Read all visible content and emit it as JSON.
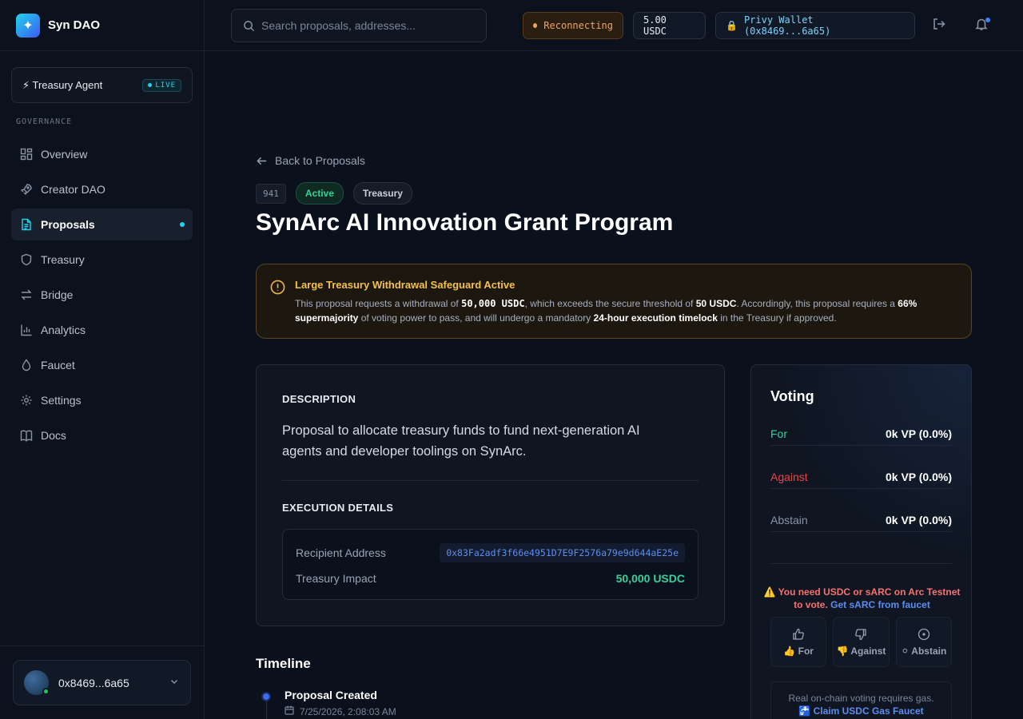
{
  "brand": {
    "name": "Syn DAO",
    "logo_icon": "sparkle-icon"
  },
  "agent": {
    "label": "⚡ Treasury Agent",
    "badge": "LIVE"
  },
  "sidebar": {
    "section": "GOVERNANCE",
    "items": [
      {
        "label": "Overview",
        "icon": "grid-icon"
      },
      {
        "label": "Creator DAO",
        "icon": "rocket-icon"
      },
      {
        "label": "Proposals",
        "icon": "document-icon",
        "active": true
      },
      {
        "label": "Treasury",
        "icon": "shield-icon"
      },
      {
        "label": "Bridge",
        "icon": "swap-arrows-icon"
      },
      {
        "label": "Analytics",
        "icon": "bar-chart-icon"
      },
      {
        "label": "Faucet",
        "icon": "droplet-icon"
      },
      {
        "label": "Settings",
        "icon": "gear-icon"
      },
      {
        "label": "Docs",
        "icon": "book-icon"
      }
    ],
    "user": {
      "address": "0x8469...6a65"
    }
  },
  "topbar": {
    "search": {
      "placeholder": "Search proposals, addresses...",
      "value": ""
    },
    "status": "Reconnecting",
    "balance": "5.00 USDC",
    "wallet": "Privy Wallet (0x8469...6a65)"
  },
  "proposal": {
    "back_label": "Back to Proposals",
    "id": "941",
    "status": "Active",
    "type": "Treasury",
    "title": "SynArc AI Innovation Grant Program",
    "alert": {
      "title": "Large Treasury Withdrawal Safeguard Active",
      "p1": "This proposal requests a withdrawal of ",
      "amount": "50,000 USDC",
      "p2": ", which exceeds the secure threshold of ",
      "threshold": "50 USDC",
      "p3": ". Accordingly, this proposal requires a ",
      "majority": "66% supermajority",
      "p4": " of voting power to pass, and will undergo a mandatory ",
      "timelock": "24-hour execution timelock",
      "p5": " in the Treasury if approved."
    },
    "description_label": "DESCRIPTION",
    "description": "Proposal to allocate treasury funds to fund next-generation AI agents and developer toolings on SynArc.",
    "execution_label": "EXECUTION DETAILS",
    "recipient_label": "Recipient Address",
    "recipient": "0x83Fa2adf3f66e4951D7E9F2576a79e9d644aE25e",
    "impact_label": "Treasury Impact",
    "impact": "50,000 USDC",
    "timeline_label": "Timeline",
    "timeline": [
      {
        "event": "Proposal Created",
        "time": "7/25/2026, 2:08:03 AM"
      }
    ]
  },
  "voting": {
    "title": "Voting",
    "rows": [
      {
        "label": "For",
        "value": "0k VP (0.0%)"
      },
      {
        "label": "Against",
        "value": "0k VP (0.0%)"
      },
      {
        "label": "Abstain",
        "value": "0k VP (0.0%)"
      }
    ],
    "warning": "⚠️ You need USDC or sARC on Arc Testnet to vote.",
    "warning_link": "Get sARC from faucet",
    "buttons": [
      {
        "label": "👍 For",
        "icon": "thumbs-up-icon"
      },
      {
        "label": "👎 Against",
        "icon": "thumbs-down-icon"
      },
      {
        "label": "⚪ Abstain",
        "icon": "circle-dot-icon"
      }
    ],
    "gas_note": "Real on-chain voting requires gas.",
    "gas_link": "🚰 Claim USDC Gas Faucet"
  }
}
